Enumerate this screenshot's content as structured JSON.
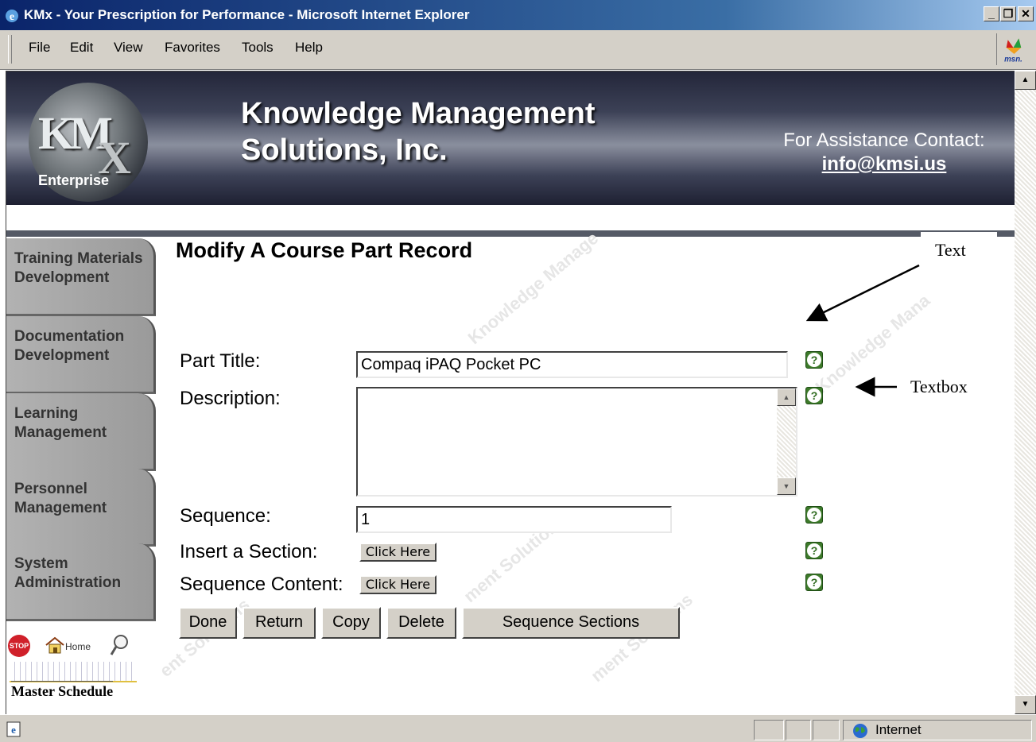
{
  "window": {
    "title": "KMx - Your Prescription for Performance - Microsoft Internet Explorer",
    "minimize": "_",
    "restore": "&#9635;",
    "close": "X"
  },
  "menu": {
    "items": [
      "File",
      "Edit",
      "View",
      "Favorites",
      "Tools",
      "Help"
    ]
  },
  "banner": {
    "logo_letters": "KM",
    "logo_x": "X",
    "logo_sub": "Enterprise",
    "company_line1": "Knowledge Management",
    "company_line2": "Solutions, Inc.",
    "assist_label": "For Assistance Contact:",
    "assist_email": "info@kmsi.us"
  },
  "nav": {
    "items": [
      "Training Materials Development",
      "Documentation Development",
      "Learning Management",
      "Personnel Management",
      "System Administration"
    ],
    "stop": "STOP",
    "home": "Home",
    "schedule": "Master Schedule"
  },
  "form": {
    "page_title": "Modify A Course Part Record",
    "part_title_label": "Part Title:",
    "part_title_value": "Compaq iPAQ Pocket PC",
    "description_label": "Description:",
    "description_value": "",
    "sequence_label": "Sequence:",
    "sequence_value": "1",
    "insert_section_label": "Insert a Section:",
    "sequence_content_label": "Sequence Content:",
    "click_here": "Click Here",
    "help": "?",
    "buttons": {
      "done": "Done",
      "return": "Return",
      "copy": "Copy",
      "delete": "Delete",
      "sequence_sections": "Sequence Sections"
    }
  },
  "annotations": {
    "text": "Text",
    "textbox": "Textbox"
  },
  "status": {
    "zone": "Internet"
  }
}
